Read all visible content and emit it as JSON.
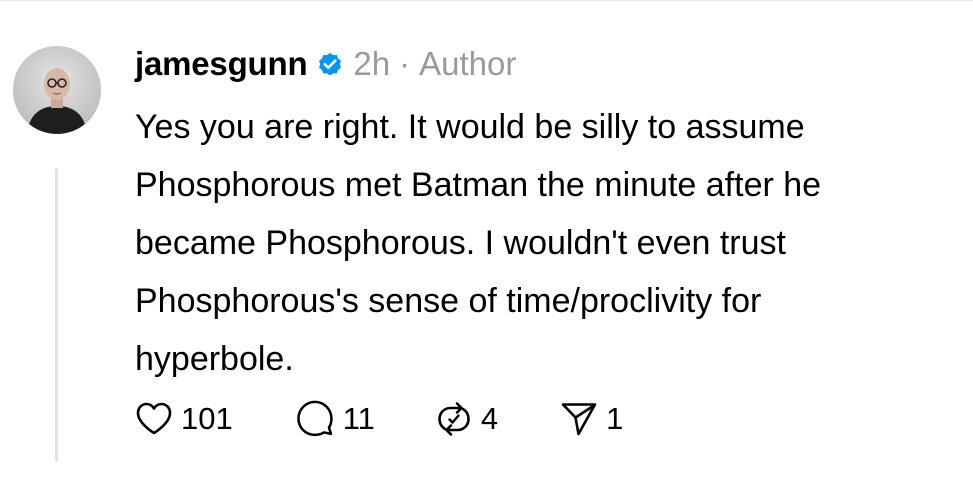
{
  "post": {
    "author": {
      "username": "jamesgunn",
      "verified": true,
      "verified_icon": "verified-badge-icon",
      "avatar_icon": "profile-photo"
    },
    "timestamp": "2h",
    "separator": "·",
    "role_label": "Author",
    "text_lines": [
      "Yes you are right. It would be silly to assume",
      "Phosphorous met Batman the minute after he",
      "became Phosphorous. I wouldn't even trust",
      "Phosphorous's sense of time/proclivity for",
      "hyperbole."
    ],
    "actions": {
      "likes": {
        "icon": "heart-icon",
        "count": "101"
      },
      "replies": {
        "icon": "comment-icon",
        "count": "11"
      },
      "reposts": {
        "icon": "repost-icon",
        "count": "4"
      },
      "shares": {
        "icon": "send-icon",
        "count": "1"
      }
    }
  },
  "colors": {
    "verified_blue": "#0095f6",
    "muted_text": "#9a9a9a",
    "thread_line": "#e3e3e3",
    "text": "#000000"
  }
}
